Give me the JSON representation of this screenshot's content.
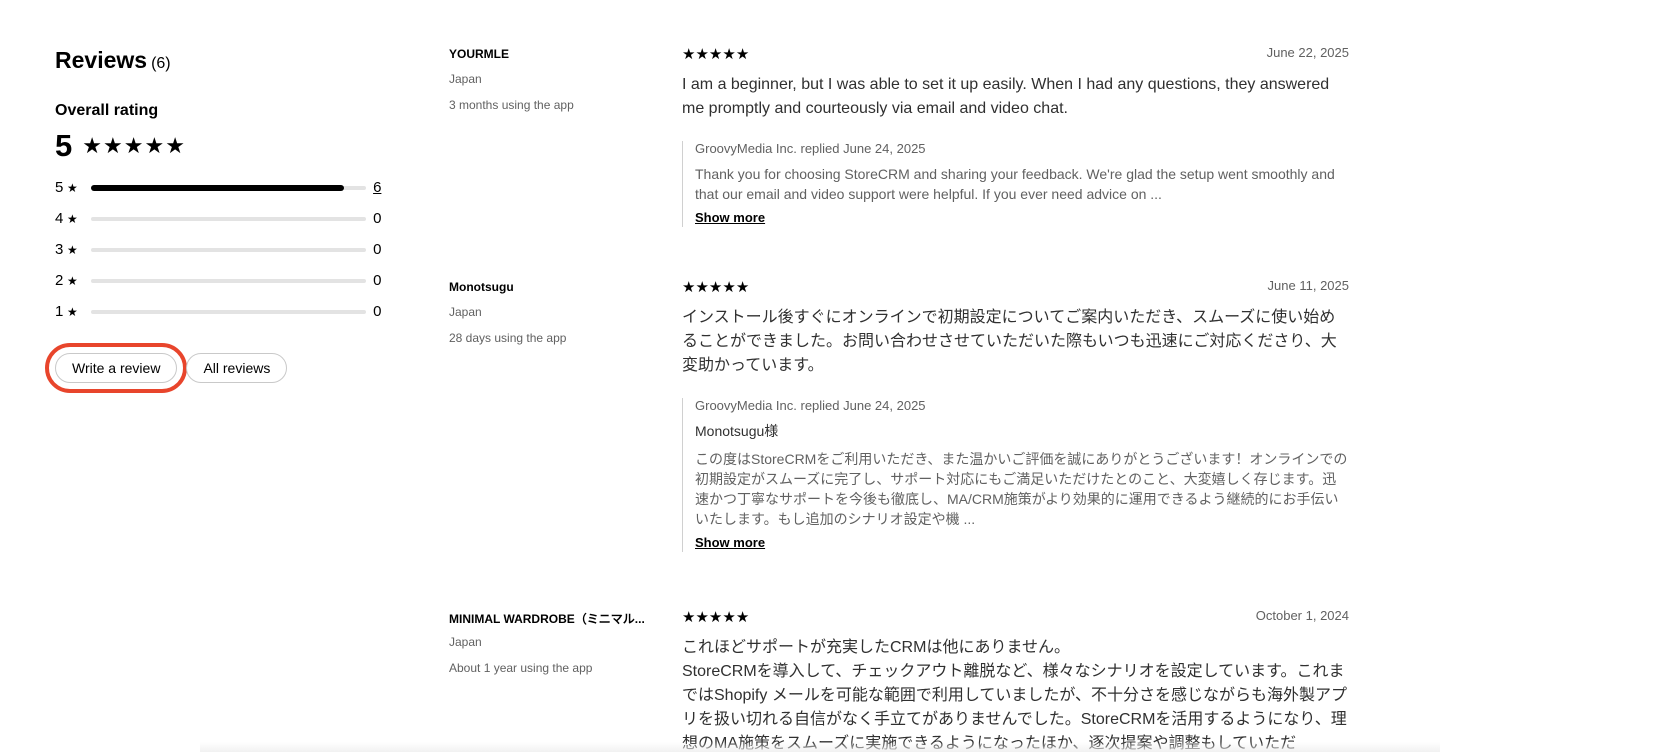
{
  "reviews_header": {
    "title": "Reviews",
    "count": "(6)"
  },
  "overall": {
    "label": "Overall rating",
    "score": "5"
  },
  "distribution": [
    {
      "stars": "5",
      "count": "6",
      "fraction": 1.0
    },
    {
      "stars": "4",
      "count": "0",
      "fraction": 0
    },
    {
      "stars": "3",
      "count": "0",
      "fraction": 0
    },
    {
      "stars": "2",
      "count": "0",
      "fraction": 0
    },
    {
      "stars": "1",
      "count": "0",
      "fraction": 0
    }
  ],
  "buttons": {
    "write_review": "Write a review",
    "all_reviews": "All reviews"
  },
  "reviews": [
    {
      "author": "YOURMLE",
      "country": "Japan",
      "usage": "3 months using the app",
      "rating": 5,
      "date": "June 22, 2025",
      "text": "I am a beginner, but I was able to set it up easily. When I had any questions, they answered me promptly and courteously via email and video chat.",
      "reply": {
        "head": "GroovyMedia Inc. replied June 24, 2025",
        "greeting": "",
        "text": "Thank you for choosing StoreCRM and sharing your feedback. We're glad the setup went smoothly and that our email and video support were helpful. If you ever need advice on ...",
        "show_more": "Show more"
      }
    },
    {
      "author": "Monotsugu",
      "country": "Japan",
      "usage": "28 days using the app",
      "rating": 5,
      "date": "June 11, 2025",
      "text": "インストール後すぐにオンラインで初期設定についてご案内いただき、スムーズに使い始めることができました。お問い合わせさせていただいた際もいつも迅速にご対応くださり、大変助かっています。",
      "reply": {
        "head": "GroovyMedia Inc. replied June 24, 2025",
        "greeting": "Monotsugu様",
        "text": "この度はStoreCRMをご利用いただき、また温かいご評価を誠にありがとうございます！オンラインでの初期設定がスムーズに完了し、サポート対応にもご満足いただけたとのこと、大変嬉しく存じます。迅速かつ丁寧なサポートを今後も徹底し、MA/CRM施策がより効果的に運用できるよう継続的にお手伝いいたします。もし追加のシナリオ設定や機 ...",
        "show_more": "Show more"
      }
    },
    {
      "author": "MINIMAL WARDROBE（ミニマル...",
      "country": "Japan",
      "usage": "About 1 year using the app",
      "rating": 5,
      "date": "October 1, 2024",
      "text": "これほどサポートが充実したCRMは他にありません。\nStoreCRMを導入して、チェックアウト離脱など、様々なシナリオを設定しています。これまではShopify メールを可能な範囲で利用していましたが、不十分さを感じながらも海外製アプリを扱い切れる自信がなく手立てがありませんでした。StoreCRMを活用するようになり、理想のMA施策をスムーズに実施できるようになったほか、逐次提案や調整もしていただ"
    }
  ],
  "icons": {
    "star": "star-icon"
  },
  "colors": {
    "highlight": "#e8452c",
    "bar_fill": "#000000",
    "bar_track": "#e3e3e3"
  }
}
